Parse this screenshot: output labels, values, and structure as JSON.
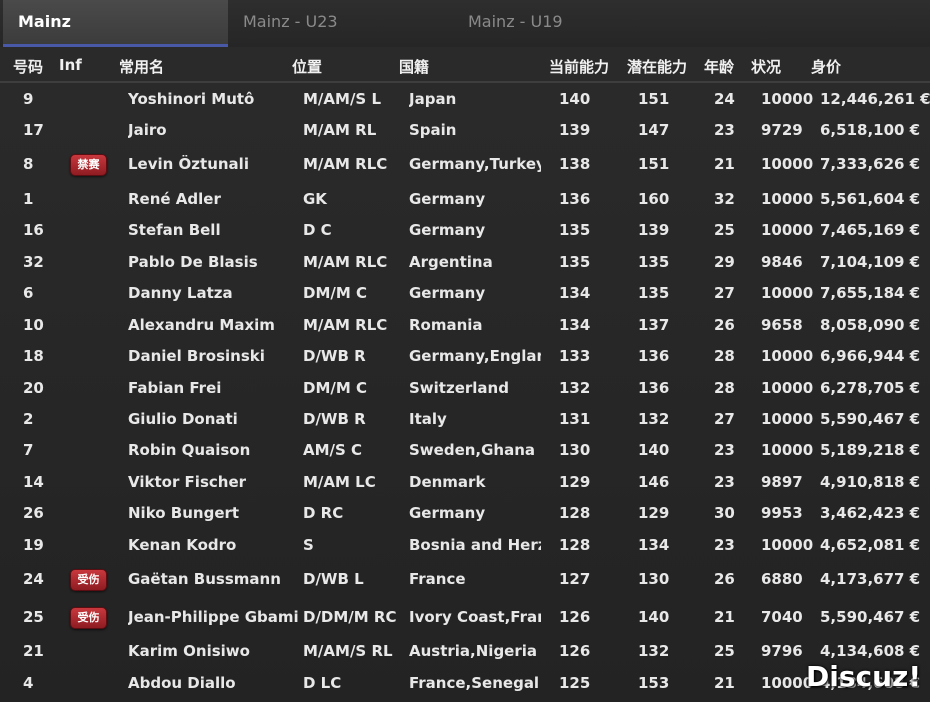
{
  "tabs": [
    "Mainz",
    "Mainz - U23",
    "Mainz - U19"
  ],
  "columns": [
    "号码",
    "Inf",
    "常用名",
    "位置",
    "国籍",
    "当前能力",
    "潜在能力",
    "年龄",
    "状况",
    "身价"
  ],
  "rows": [
    {
      "num": "9",
      "inf": "",
      "name": "Yoshinori Mutô",
      "pos": "M/AM/S L",
      "nat": "Japan",
      "ca": "140",
      "pa": "151",
      "age": "24",
      "cond": "10000",
      "value": "12,446,261 €"
    },
    {
      "num": "17",
      "inf": "",
      "name": "Jairo",
      "pos": "M/AM RL",
      "nat": "Spain",
      "ca": "139",
      "pa": "147",
      "age": "23",
      "cond": "9729",
      "value": "6,518,100 €"
    },
    {
      "num": "8",
      "inf": "禁赛",
      "name": "Levin Öztunali",
      "pos": "M/AM RLC",
      "nat": "Germany,Turkey",
      "ca": "138",
      "pa": "151",
      "age": "21",
      "cond": "10000",
      "value": "7,333,626 €"
    },
    {
      "num": "1",
      "inf": "",
      "name": "René Adler",
      "pos": "GK",
      "nat": "Germany",
      "ca": "136",
      "pa": "160",
      "age": "32",
      "cond": "10000",
      "value": "5,561,604 €"
    },
    {
      "num": "16",
      "inf": "",
      "name": "Stefan Bell",
      "pos": "D C",
      "nat": "Germany",
      "ca": "135",
      "pa": "139",
      "age": "25",
      "cond": "10000",
      "value": "7,465,169 €"
    },
    {
      "num": "32",
      "inf": "",
      "name": "Pablo De Blasis",
      "pos": "M/AM RLC",
      "nat": "Argentina",
      "ca": "135",
      "pa": "135",
      "age": "29",
      "cond": "9846",
      "value": "7,104,109 €"
    },
    {
      "num": "6",
      "inf": "",
      "name": "Danny Latza",
      "pos": "DM/M C",
      "nat": "Germany",
      "ca": "134",
      "pa": "135",
      "age": "27",
      "cond": "10000",
      "value": "7,655,184 €"
    },
    {
      "num": "10",
      "inf": "",
      "name": "Alexandru Maxim",
      "pos": "M/AM RLC",
      "nat": "Romania",
      "ca": "134",
      "pa": "137",
      "age": "26",
      "cond": "9658",
      "value": "8,058,090 €"
    },
    {
      "num": "18",
      "inf": "",
      "name": "Daniel Brosinski",
      "pos": "D/WB R",
      "nat": "Germany,England",
      "ca": "133",
      "pa": "136",
      "age": "28",
      "cond": "10000",
      "value": "6,966,944 €"
    },
    {
      "num": "20",
      "inf": "",
      "name": "Fabian Frei",
      "pos": "DM/M C",
      "nat": "Switzerland",
      "ca": "132",
      "pa": "136",
      "age": "28",
      "cond": "10000",
      "value": "6,278,705 €"
    },
    {
      "num": "2",
      "inf": "",
      "name": "Giulio Donati",
      "pos": "D/WB R",
      "nat": "Italy",
      "ca": "131",
      "pa": "132",
      "age": "27",
      "cond": "10000",
      "value": "5,590,467 €"
    },
    {
      "num": "7",
      "inf": "",
      "name": "Robin Quaison",
      "pos": "AM/S C",
      "nat": "Sweden,Ghana",
      "ca": "130",
      "pa": "140",
      "age": "23",
      "cond": "10000",
      "value": "5,189,218 €"
    },
    {
      "num": "14",
      "inf": "",
      "name": "Viktor Fischer",
      "pos": "M/AM LC",
      "nat": "Denmark",
      "ca": "129",
      "pa": "146",
      "age": "23",
      "cond": "9897",
      "value": "4,910,818 €"
    },
    {
      "num": "26",
      "inf": "",
      "name": "Niko Bungert",
      "pos": "D RC",
      "nat": "Germany",
      "ca": "128",
      "pa": "129",
      "age": "30",
      "cond": "9953",
      "value": "3,462,423 €"
    },
    {
      "num": "19",
      "inf": "",
      "name": "Kenan Kodro",
      "pos": "S",
      "nat": "Bosnia and Herzegovina",
      "ca": "128",
      "pa": "134",
      "age": "23",
      "cond": "10000",
      "value": "4,652,081 €"
    },
    {
      "num": "24",
      "inf": "受伤",
      "name": "Gaëtan Bussmann",
      "pos": "D/WB L",
      "nat": "France",
      "ca": "127",
      "pa": "130",
      "age": "26",
      "cond": "6880",
      "value": "4,173,677 €"
    },
    {
      "num": "25",
      "inf": "受伤",
      "name": "Jean-Philippe Gbamin",
      "pos": "D/DM/M RC",
      "nat": "Ivory Coast,France",
      "ca": "126",
      "pa": "140",
      "age": "21",
      "cond": "7040",
      "value": "5,590,467 €"
    },
    {
      "num": "21",
      "inf": "",
      "name": "Karim Onisiwo",
      "pos": "M/AM/S RL",
      "nat": "Austria,Nigeria",
      "ca": "126",
      "pa": "132",
      "age": "25",
      "cond": "9796",
      "value": "4,134,608 €"
    },
    {
      "num": "4",
      "inf": "",
      "name": "Abdou Diallo",
      "pos": "D LC",
      "nat": "France,Senegal",
      "ca": "125",
      "pa": "153",
      "age": "21",
      "cond": "10000",
      "value": "4,134,608 €"
    }
  ],
  "watermark": "Discuz!"
}
